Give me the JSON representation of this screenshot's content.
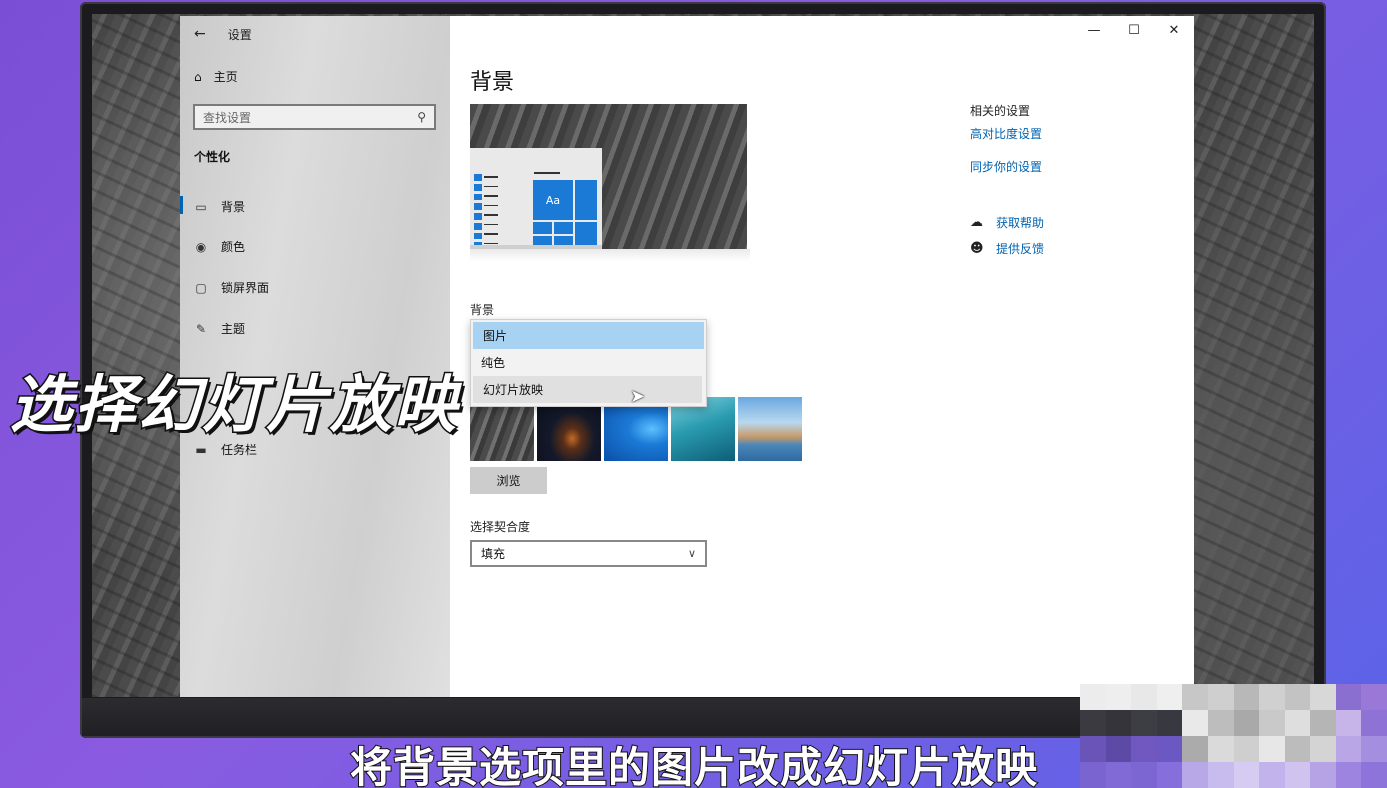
{
  "window": {
    "title": "设置",
    "controls": {
      "minimize": "—",
      "maximize": "☐",
      "close": "✕"
    }
  },
  "sidebar": {
    "home": "主页",
    "search_placeholder": "查找设置",
    "section": "个性化",
    "items": [
      {
        "label": "背景",
        "icon": "picture-icon",
        "active": true
      },
      {
        "label": "颜色",
        "icon": "palette-icon",
        "active": false
      },
      {
        "label": "锁屏界面",
        "icon": "lockscreen-icon",
        "active": false
      },
      {
        "label": "主题",
        "icon": "theme-brush-icon",
        "active": false
      },
      {
        "label": "任务栏",
        "icon": "taskbar-icon",
        "active": false
      }
    ]
  },
  "main": {
    "title": "背景",
    "preview_tile_label": "Aa",
    "background_label": "背景",
    "dropdown_options": [
      {
        "label": "图片",
        "state": "selected"
      },
      {
        "label": "纯色",
        "state": "normal"
      },
      {
        "label": "幻灯片放映",
        "state": "hover"
      }
    ],
    "browse_button": "浏览",
    "fit_label": "选择契合度",
    "fit_value": "填充"
  },
  "related": {
    "title": "相关的设置",
    "links": [
      "高对比度设置",
      "同步你的设置"
    ],
    "help": [
      {
        "label": "获取帮助",
        "icon": "help-chat-icon"
      },
      {
        "label": "提供反馈",
        "icon": "feedback-icon"
      }
    ]
  },
  "overlay": {
    "title": "选择幻灯片放映",
    "subtitle": "将背景选项里的图片改成幻灯片放映"
  },
  "colors": {
    "accent": "#0063b1",
    "tile_blue": "#1b7ad6",
    "dropdown_selected": "#a7d2f2"
  }
}
